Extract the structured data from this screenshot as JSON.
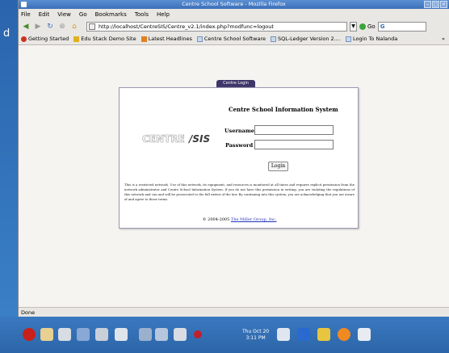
{
  "desktop": {
    "text": "d"
  },
  "window": {
    "title": "Centre School Software - Mozilla Firefox"
  },
  "menu": [
    "File",
    "Edit",
    "View",
    "Go",
    "Bookmarks",
    "Tools",
    "Help"
  ],
  "nav": {
    "url": "http://localhost/CentreSIS/Centre_v2.1/index.php?modfunc=logout",
    "go_label": "Go",
    "search_value": "G"
  },
  "bookmarks": [
    {
      "label": "Getting Started",
      "icon": "red"
    },
    {
      "label": "Edu Stack Demo Site",
      "icon": "star"
    },
    {
      "label": "Latest Headlines",
      "icon": "rss"
    },
    {
      "label": "Centre School Software",
      "icon": "page"
    },
    {
      "label": "SQL-Ledger Version 2....",
      "icon": "page"
    },
    {
      "label": "Login To Nalanda",
      "icon": "page"
    }
  ],
  "login": {
    "tab": "Centre Login",
    "system_title": "Centre School Information System",
    "logo_left": "CENTRE",
    "logo_right": "/SIS",
    "username_label": "Username",
    "password_label": "Password",
    "login_button": "Login",
    "notice": "This is a restricted network. Use of this network, its equipment, and resources is monitored at all times and requires explicit permission from the network administrator and Centre School Information System. If you do not have this permission in writing, you are violating the regulations of this network and can and will be prosecuted to the full extent of the law. By continuing into this system, you are acknowledging that you are aware of and agree to these terms.",
    "copyright_prefix": "© 2004-2005 ",
    "copyright_link": "The Miller Group, Inc."
  },
  "status": "Done",
  "clock": {
    "day": "Thu Oct 20",
    "time": "3:11 PM"
  }
}
